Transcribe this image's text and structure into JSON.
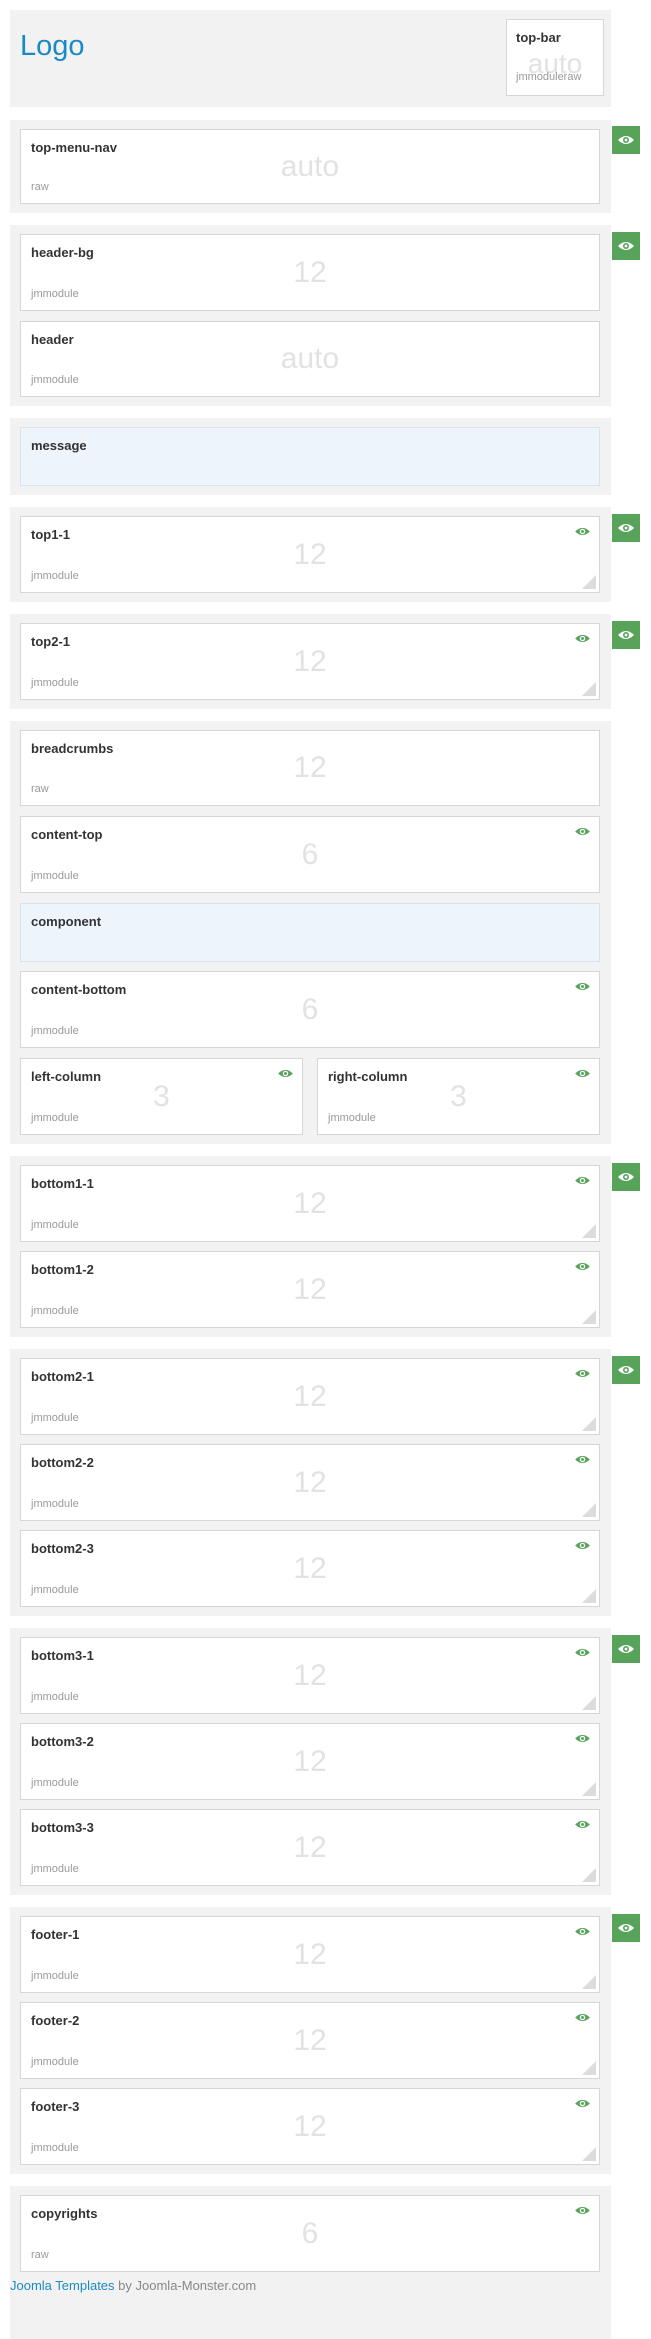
{
  "logo": "Logo",
  "top_bar": {
    "name": "top-bar",
    "size": "auto",
    "type": "jmmoduleraw"
  },
  "modules": {
    "top_menu_nav": {
      "name": "top-menu-nav",
      "size": "auto",
      "type": "raw"
    },
    "header_bg": {
      "name": "header-bg",
      "size": "12",
      "type": "jmmodule"
    },
    "header": {
      "name": "header",
      "size": "auto",
      "type": "jmmodule"
    },
    "message": {
      "name": "message"
    },
    "top1_1": {
      "name": "top1-1",
      "size": "12",
      "type": "jmmodule"
    },
    "top2_1": {
      "name": "top2-1",
      "size": "12",
      "type": "jmmodule"
    },
    "breadcrumbs": {
      "name": "breadcrumbs",
      "size": "12",
      "type": "raw"
    },
    "content_top": {
      "name": "content-top",
      "size": "6",
      "type": "jmmodule"
    },
    "component": {
      "name": "component"
    },
    "content_bottom": {
      "name": "content-bottom",
      "size": "6",
      "type": "jmmodule"
    },
    "left_column": {
      "name": "left-column",
      "size": "3",
      "type": "jmmodule"
    },
    "right_column": {
      "name": "right-column",
      "size": "3",
      "type": "jmmodule"
    },
    "bottom1_1": {
      "name": "bottom1-1",
      "size": "12",
      "type": "jmmodule"
    },
    "bottom1_2": {
      "name": "bottom1-2",
      "size": "12",
      "type": "jmmodule"
    },
    "bottom2_1": {
      "name": "bottom2-1",
      "size": "12",
      "type": "jmmodule"
    },
    "bottom2_2": {
      "name": "bottom2-2",
      "size": "12",
      "type": "jmmodule"
    },
    "bottom2_3": {
      "name": "bottom2-3",
      "size": "12",
      "type": "jmmodule"
    },
    "bottom3_1": {
      "name": "bottom3-1",
      "size": "12",
      "type": "jmmodule"
    },
    "bottom3_2": {
      "name": "bottom3-2",
      "size": "12",
      "type": "jmmodule"
    },
    "bottom3_3": {
      "name": "bottom3-3",
      "size": "12",
      "type": "jmmodule"
    },
    "footer_1": {
      "name": "footer-1",
      "size": "12",
      "type": "jmmodule"
    },
    "footer_2": {
      "name": "footer-2",
      "size": "12",
      "type": "jmmodule"
    },
    "footer_3": {
      "name": "footer-3",
      "size": "12",
      "type": "jmmodule"
    },
    "copyrights": {
      "name": "copyrights",
      "size": "6",
      "type": "raw"
    }
  },
  "footer": {
    "link_text": "Joomla Templates",
    "by_text": "by Joomla-Monster.com"
  },
  "icons": {
    "visibility": "eye-icon",
    "resize": "resize-handle-icon"
  },
  "colors": {
    "accent": "#1a8ac6",
    "visibility_green": "#57a35a",
    "special_bg": "#eef4fc"
  }
}
